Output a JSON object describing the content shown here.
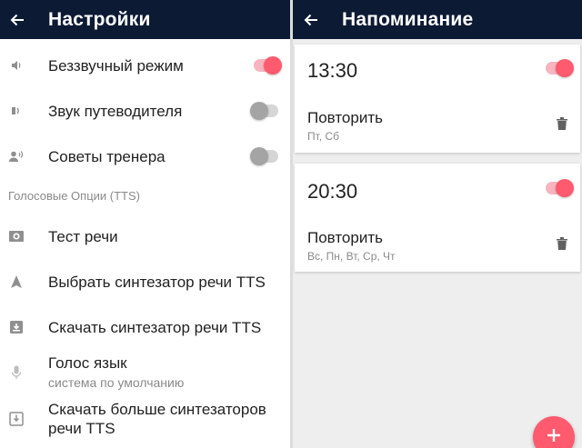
{
  "left": {
    "title": "Настройки",
    "rows": [
      {
        "label": "Беззвучный режим",
        "icon": "speaker-icon",
        "toggle": true
      },
      {
        "label": "Звук путеводителя",
        "icon": "guide-sound-icon",
        "toggle": false
      },
      {
        "label": "Советы тренера",
        "icon": "coach-voice-icon",
        "toggle": false
      }
    ],
    "section": "Голосовые Опции (TTS)",
    "tts": [
      {
        "label": "Тест речи",
        "icon": "speech-test-icon"
      },
      {
        "label": "Выбрать синтезатор речи TTS",
        "icon": "navigation-arrow-icon"
      },
      {
        "label": "Скачать синтезатор речи TTS",
        "icon": "download-box-icon"
      },
      {
        "label": "Голос язык",
        "sub": "система по умолчанию",
        "icon": "microphone-icon"
      },
      {
        "label": "Скачать больше синтезаторов",
        "label2": "речи TTS",
        "icon": "download-tray-icon"
      }
    ]
  },
  "right": {
    "title": "Напоминание",
    "reminders": [
      {
        "time": "13:30",
        "repeat_label": "Повторить",
        "days": "Пт, Сб",
        "enabled": true
      },
      {
        "time": "20:30",
        "repeat_label": "Повторить",
        "days": "Вс, Пн, Вт, Ср, Чт",
        "enabled": true
      }
    ],
    "fab_icon": "plus-icon"
  },
  "colors": {
    "appbar": "#0d1a33",
    "accent": "#ff5a6e",
    "accent_track": "#f8b4bf",
    "icon_gray": "#8f8f8f"
  }
}
